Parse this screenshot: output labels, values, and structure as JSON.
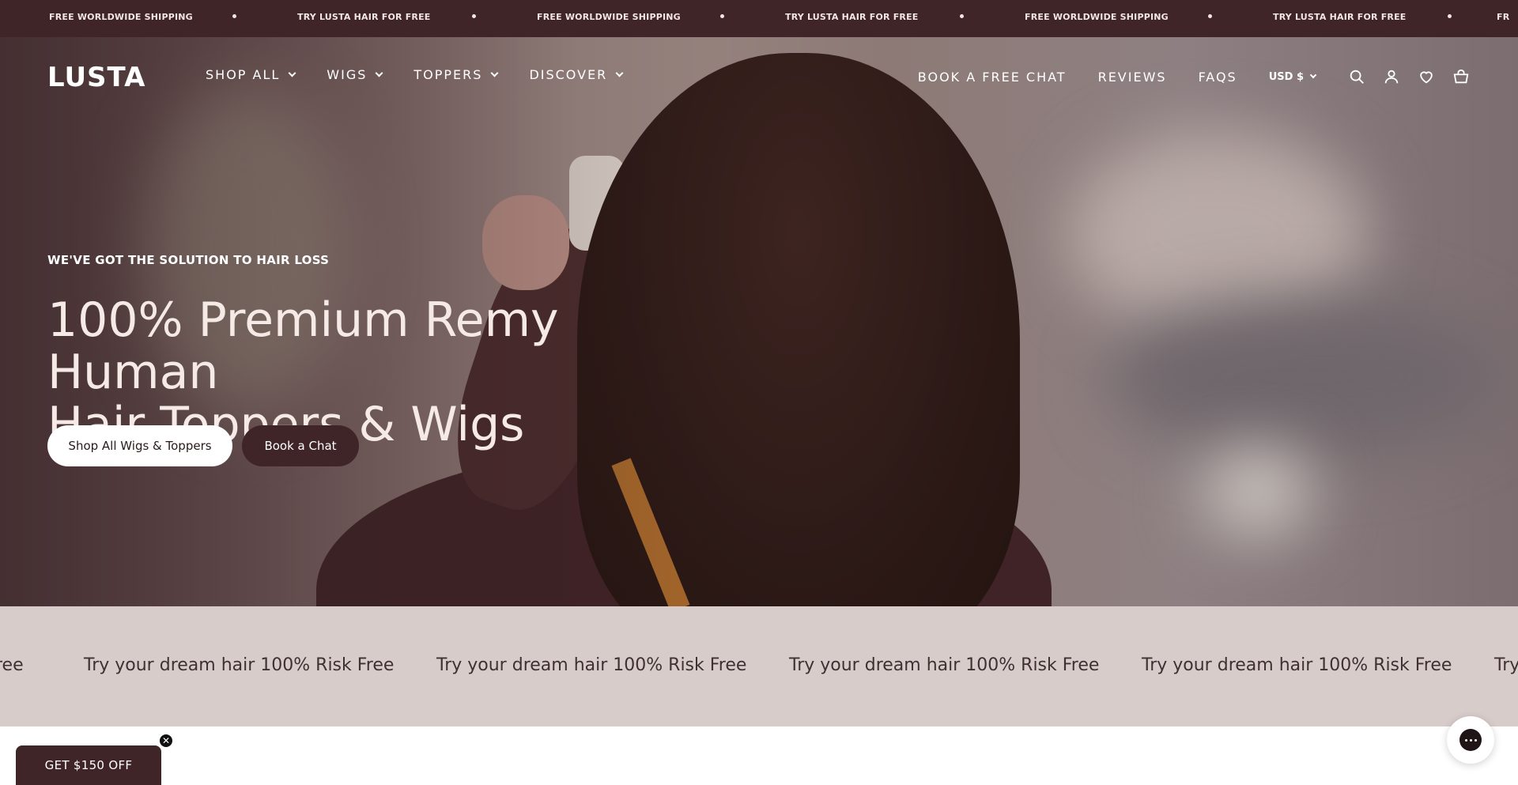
{
  "announcement": {
    "items": [
      "FREE WORLDWIDE SHIPPING",
      "TRY LUSTA HAIR FOR FREE",
      "FREE WORLDWIDE SHIPPING",
      "TRY LUSTA HAIR FOR FREE",
      "FREE WORLDWIDE SHIPPING",
      "TRY LUSTA HAIR FOR FREE",
      "FR"
    ]
  },
  "header": {
    "logo": "LUSTA",
    "nav_left": [
      "SHOP ALL",
      "WIGS",
      "TOPPERS",
      "DISCOVER"
    ],
    "nav_right": [
      "BOOK A FREE CHAT",
      "REVIEWS",
      "FAQS"
    ],
    "currency": "USD $",
    "icons": [
      "search-icon",
      "account-icon",
      "heart-icon",
      "cart-icon"
    ]
  },
  "hero": {
    "eyebrow": "WE'VE GOT THE SOLUTION TO HAIR LOSS",
    "headline_line1": "100% Premium Remy Human",
    "headline_line2": "Hair Toppers & Wigs",
    "primary_button": "Shop All Wigs & Toppers",
    "secondary_button": "Book a Chat"
  },
  "marquee": {
    "items": [
      "ree",
      "Try your dream hair 100% Risk Free",
      "Try your dream hair 100% Risk Free",
      "Try your dream hair 100% Risk Free",
      "Try your dream hair 100% Risk Free",
      "Try"
    ]
  },
  "promo": {
    "label": "GET $150 OFF",
    "close": "✕"
  },
  "colors": {
    "brand_dark": "#3f2428",
    "marquee_bg": "#d8cccb",
    "white": "#ffffff"
  }
}
